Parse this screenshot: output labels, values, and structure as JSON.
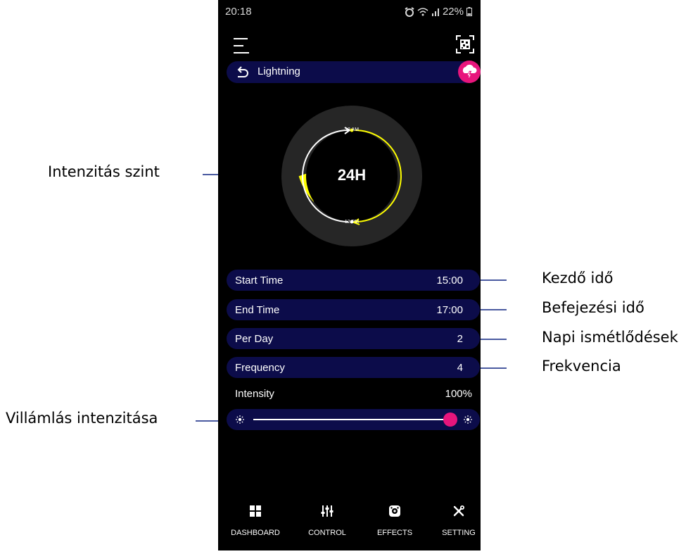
{
  "callouts": {
    "intensity_level": "Intenzitás szint",
    "start_time": "Kezdő idő",
    "end_time": "Befejezési idő",
    "per_day": "Napi ismétlődések",
    "frequency": "Frekvencia",
    "lightning_intensity": "Villámlás intenzitása"
  },
  "status_bar": {
    "time": "20:18",
    "battery": "22%"
  },
  "effect": {
    "title": "Lightning",
    "badge_icon": "cloud-lightning-icon"
  },
  "clock": {
    "center_label": "24H",
    "top_mark": "12 AM",
    "bottom_mark": "12 PM"
  },
  "rows": {
    "start_time": {
      "label": "Start Time",
      "value": "15:00"
    },
    "end_time": {
      "label": "End Time",
      "value": "17:00"
    },
    "per_day": {
      "label": "Per Day",
      "value": "2"
    },
    "frequency": {
      "label": "Frequency",
      "value": "4"
    }
  },
  "intensity": {
    "label": "Intensity",
    "value": "100%",
    "level": 1.0
  },
  "nav": {
    "dashboard": "DASHBOARD",
    "control": "CONTROL",
    "effects": "EFFECTS",
    "setting": "SETTING"
  },
  "colors": {
    "accent": "#e8157c",
    "pill": "#0c0c4a",
    "highlight": "#ffff00",
    "callout_line": "#4a5aa0"
  }
}
